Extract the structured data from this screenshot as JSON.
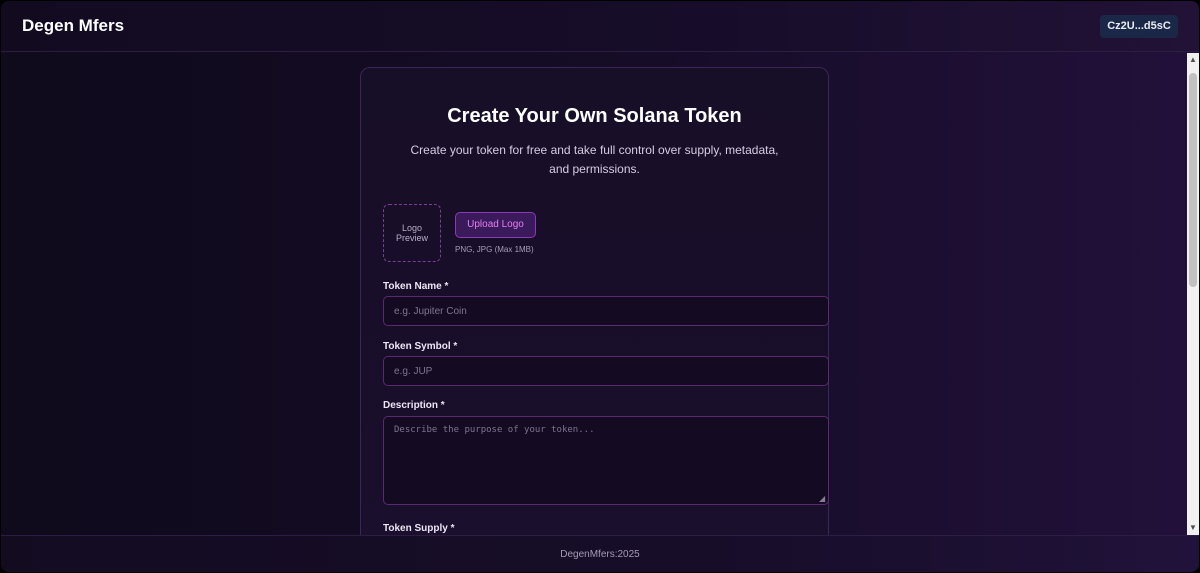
{
  "header": {
    "brand": "Degen Mfers",
    "wallet_label": "Cz2U...d5sC"
  },
  "form": {
    "title": "Create Your Own Solana Token",
    "subtitle": "Create your token for free and take full control over supply, metadata, and permissions.",
    "logo": {
      "preview_text": "Logo Preview",
      "upload_label": "Upload Logo",
      "hint": "PNG, JPG (Max 1MB)"
    },
    "token_name": {
      "label": "Token Name *",
      "value": "",
      "placeholder": "e.g. Jupiter Coin"
    },
    "token_symbol": {
      "label": "Token Symbol *",
      "value": "",
      "placeholder": "e.g. JUP"
    },
    "description": {
      "label": "Description *",
      "value": "",
      "placeholder": "Describe the purpose of your token..."
    },
    "token_supply": {
      "label": "Token Supply *"
    }
  },
  "footer": {
    "text": "DegenMfers:2025"
  },
  "colors": {
    "accent": "#e27ef5",
    "border": "#5a2a70",
    "background": "#150c26"
  },
  "icons": {
    "scroll_up": "triangle-up",
    "scroll_down": "triangle-down",
    "resize_grip": "diagonal-lines"
  }
}
